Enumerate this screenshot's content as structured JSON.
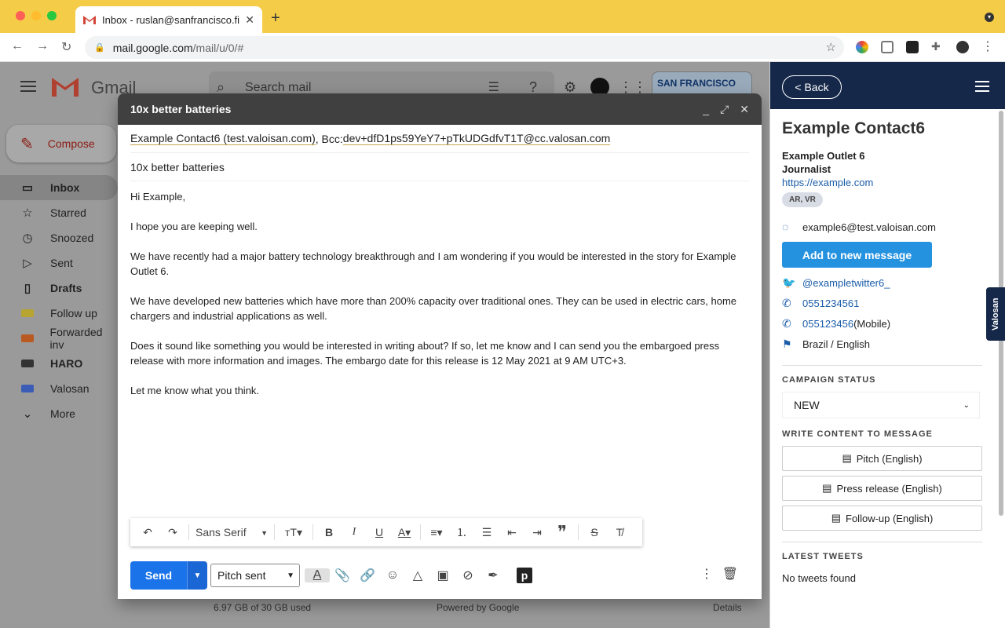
{
  "browser": {
    "tab_title": "Inbox - ruslan@sanfrancisco.fi",
    "url_host": "mail.google.com",
    "url_path": "/mail/u/0/#"
  },
  "gmail": {
    "logo_text": "Gmail",
    "search_placeholder": "Search mail",
    "compose_label": "Compose",
    "nav": [
      {
        "label": "Inbox",
        "icon": "inbox-icon"
      },
      {
        "label": "Starred",
        "icon": "star-icon"
      },
      {
        "label": "Snoozed",
        "icon": "clock-icon"
      },
      {
        "label": "Sent",
        "icon": "send-icon"
      },
      {
        "label": "Drafts",
        "icon": "file-icon"
      },
      {
        "label": "Follow up",
        "icon": "label-icon",
        "color": "#b8a431"
      },
      {
        "label": "Forwarded inv",
        "icon": "label-icon",
        "color": "#b85a21"
      },
      {
        "label": "HARO",
        "icon": "label-icon",
        "color": "#333333"
      },
      {
        "label": "Valosan",
        "icon": "label-icon",
        "color": "#3b5db5"
      },
      {
        "label": "More",
        "icon": "chevron-down-icon"
      }
    ],
    "storage": "6.97 GB of 30 GB used",
    "powered": "Powered by Google",
    "details": "Details",
    "badge_text": "SAN FRANCISCO"
  },
  "compose": {
    "title": "10x better batteries",
    "to": "Example Contact6 (test.valoisan.com)",
    "bcc_prefix": ", Bcc: ",
    "bcc": "dev+dfD1ps59YeY7+pTkUDGdfvT1T@cc.valosan.com",
    "subject": "10x better batteries",
    "body": [
      "Hi Example,",
      "I hope you are keeping well.",
      "We have recently had a major battery technology breakthrough and I am wondering if you would be interested in the story for Example Outlet 6.",
      "We have developed new batteries which have more than 200% capacity over traditional ones. They can be used in electric cars, home chargers and industrial applications as well.",
      "Does it sound like something you would be interested in writing about? If so, let me know and I can send you the embargoed press release with more information and images. The embargo date for this release is 12 May 2021 at 9 AM UTC+3.",
      "Let me know what you think."
    ],
    "font": "Sans Serif",
    "send_label": "Send",
    "status_select": "Pitch sent"
  },
  "panel": {
    "back_label": "< Back",
    "contact_name": "Example Contact6",
    "outlet": "Example Outlet 6",
    "role": "Journalist",
    "website": "https://example.com",
    "tags": "AR, VR",
    "email": "example6@test.valoisan.com",
    "add_button": "Add to new message",
    "twitter": "@exampletwitter6_",
    "phone1": "0551234561",
    "phone2": "055123456",
    "phone2_suffix": " (Mobile)",
    "locale": "Brazil / English",
    "campaign_heading": "CAMPAIGN STATUS",
    "campaign_status": "NEW",
    "write_heading": "WRITE CONTENT TO MESSAGE",
    "write_buttons": [
      "Pitch (English)",
      "Press release (English)",
      "Follow-up (English)"
    ],
    "tweets_heading": "LATEST TWEETS",
    "tweets_empty": "No tweets found",
    "side_tab": "Valosan"
  }
}
